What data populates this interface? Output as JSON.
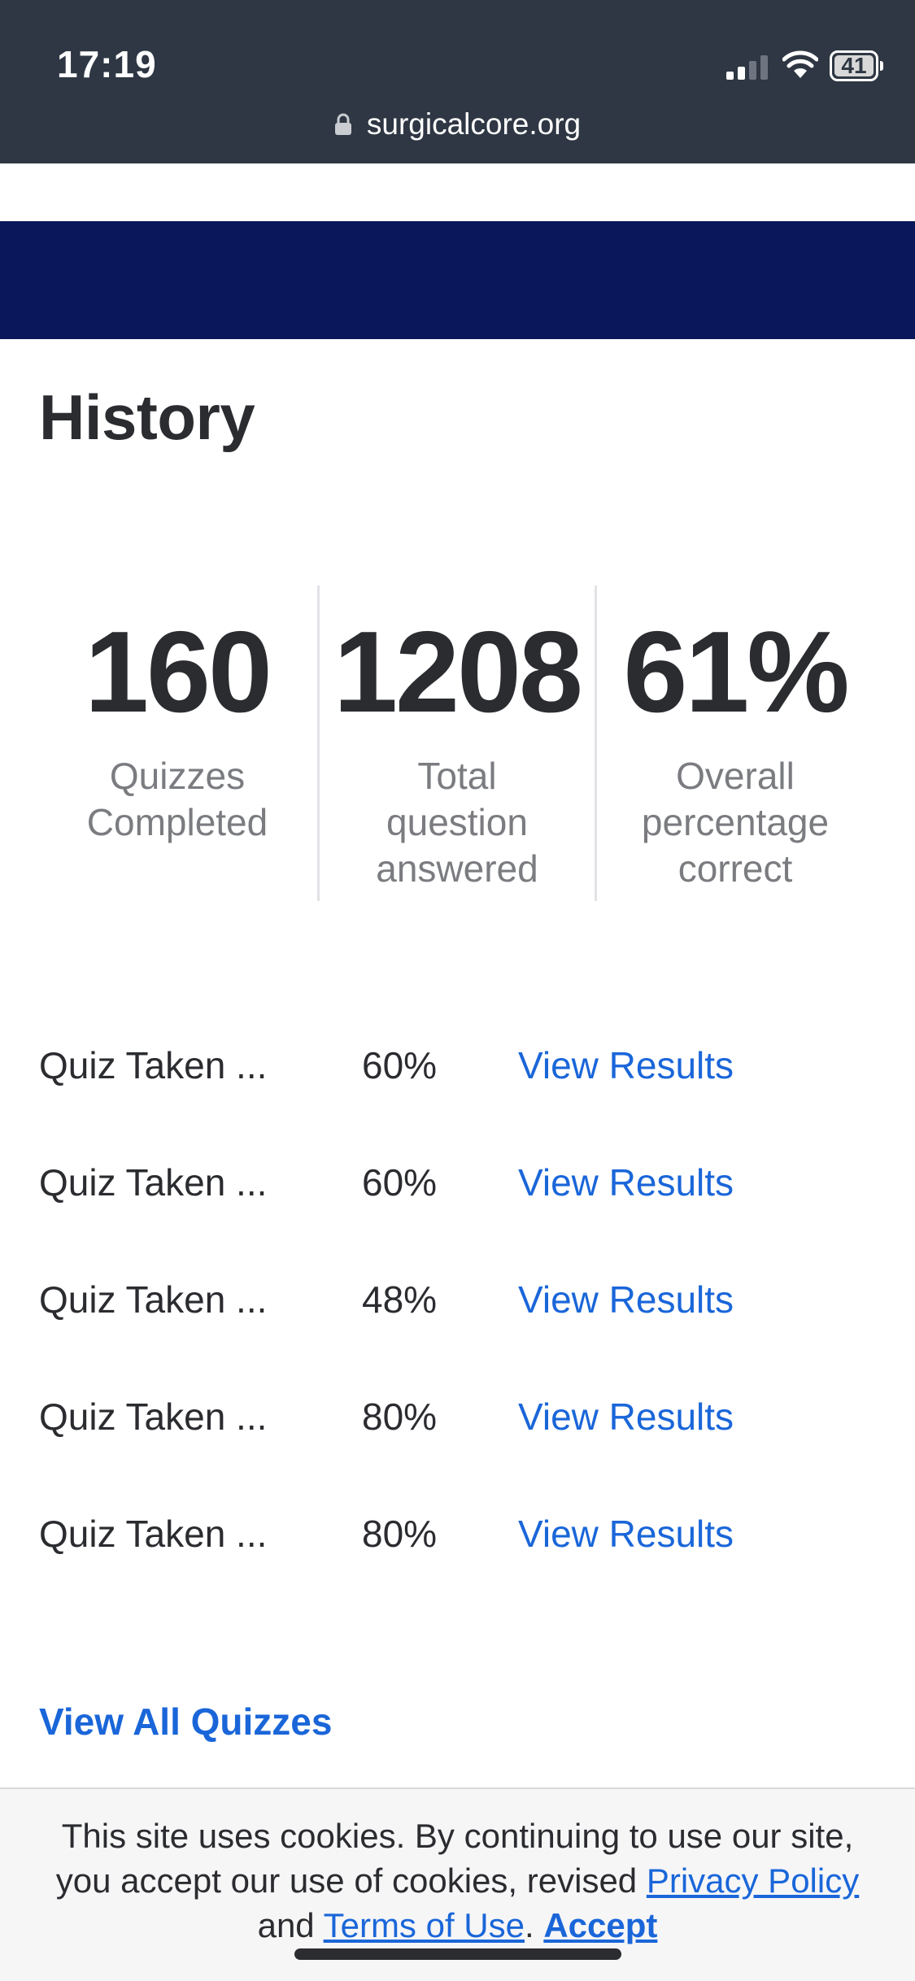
{
  "status_bar": {
    "time": "17:19",
    "battery_level": "41",
    "signal_bars_lit": 2,
    "icons": [
      "signal-icon",
      "wifi-icon",
      "battery-icon"
    ]
  },
  "browser": {
    "url": "surgicalcore.org",
    "icon": "lock-icon"
  },
  "page": {
    "title": "History"
  },
  "stats": [
    {
      "value": "160",
      "label_lines": [
        "Quizzes",
        "Completed"
      ]
    },
    {
      "value": "1208",
      "label_lines": [
        "Total",
        "question",
        "answered"
      ]
    },
    {
      "value": "61%",
      "label_lines": [
        "Overall",
        "percentage",
        "correct"
      ]
    }
  ],
  "quizzes": [
    {
      "name": "Quiz Taken ...",
      "score": "60%",
      "link": "View Results"
    },
    {
      "name": "Quiz Taken ...",
      "score": "60%",
      "link": "View Results"
    },
    {
      "name": "Quiz Taken ...",
      "score": "48%",
      "link": "View Results"
    },
    {
      "name": "Quiz Taken ...",
      "score": "80%",
      "link": "View Results"
    },
    {
      "name": "Quiz Taken ...",
      "score": "80%",
      "link": "View Results"
    }
  ],
  "view_all_label": "View All Quizzes",
  "cookie": {
    "text_before": "This site uses cookies. By continuing to use our site, you accept our use of cookies, revised ",
    "privacy_link": "Privacy Policy",
    "text_and": " and ",
    "terms_link": "Terms of Use",
    "text_period": ". ",
    "accept_label": "Accept"
  },
  "colors": {
    "topbar": "#2e3743",
    "banner": "#0b175b",
    "link": "#1a66d9",
    "text": "#2b2c30",
    "muted": "#7a7c80"
  }
}
